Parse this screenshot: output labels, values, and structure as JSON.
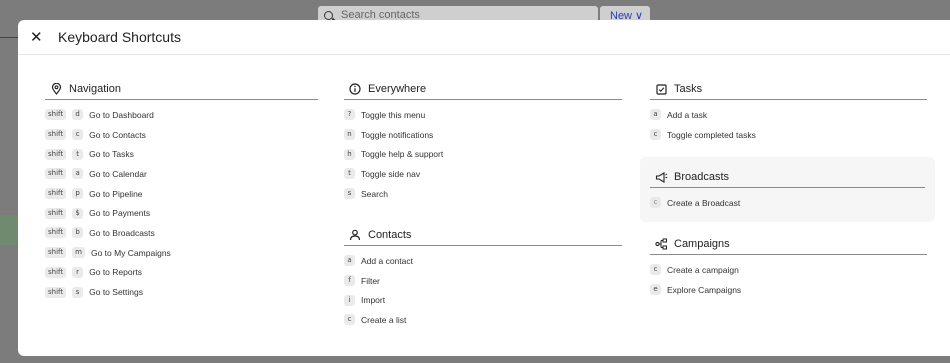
{
  "background": {
    "search_placeholder": "Search contacts",
    "new_button": "New ∨"
  },
  "modal": {
    "title": "Keyboard Shortcuts",
    "close_icon": "close-icon"
  },
  "navigation": {
    "title": "Navigation",
    "items": [
      {
        "keys": [
          "shift",
          "d"
        ],
        "label": "Go to Dashboard"
      },
      {
        "keys": [
          "shift",
          "c"
        ],
        "label": "Go to Contacts"
      },
      {
        "keys": [
          "shift",
          "t"
        ],
        "label": "Go to Tasks"
      },
      {
        "keys": [
          "shift",
          "a"
        ],
        "label": "Go to Calendar"
      },
      {
        "keys": [
          "shift",
          "p"
        ],
        "label": "Go to Pipeline"
      },
      {
        "keys": [
          "shift",
          "$"
        ],
        "label": "Go to Payments"
      },
      {
        "keys": [
          "shift",
          "b"
        ],
        "label": "Go to Broadcasts"
      },
      {
        "keys": [
          "shift",
          "m"
        ],
        "label": "Go to My Campaigns"
      },
      {
        "keys": [
          "shift",
          "r"
        ],
        "label": "Go to Reports"
      },
      {
        "keys": [
          "shift",
          "s"
        ],
        "label": "Go to Settings"
      }
    ]
  },
  "everywhere": {
    "title": "Everywhere",
    "items": [
      {
        "keys": [
          "?"
        ],
        "label": "Toggle this menu"
      },
      {
        "keys": [
          "n"
        ],
        "label": "Toggle notifications"
      },
      {
        "keys": [
          "h"
        ],
        "label": "Toggle help & support"
      },
      {
        "keys": [
          "t"
        ],
        "label": "Toggle side nav"
      },
      {
        "keys": [
          "s"
        ],
        "label": "Search"
      }
    ]
  },
  "contacts": {
    "title": "Contacts",
    "items": [
      {
        "keys": [
          "a"
        ],
        "label": "Add a contact"
      },
      {
        "keys": [
          "f"
        ],
        "label": "Filter"
      },
      {
        "keys": [
          "i"
        ],
        "label": "Import"
      },
      {
        "keys": [
          "c"
        ],
        "label": "Create a list"
      }
    ]
  },
  "tasks": {
    "title": "Tasks",
    "items": [
      {
        "keys": [
          "a"
        ],
        "label": "Add a task"
      },
      {
        "keys": [
          "c"
        ],
        "label": "Toggle completed tasks"
      }
    ]
  },
  "broadcasts": {
    "title": "Broadcasts",
    "items": [
      {
        "keys": [
          "c"
        ],
        "label": "Create a Broadcast"
      }
    ]
  },
  "campaigns": {
    "title": "Campaigns",
    "items": [
      {
        "keys": [
          "c"
        ],
        "label": "Create a campaign"
      },
      {
        "keys": [
          "e"
        ],
        "label": "Explore Campaigns"
      }
    ]
  }
}
